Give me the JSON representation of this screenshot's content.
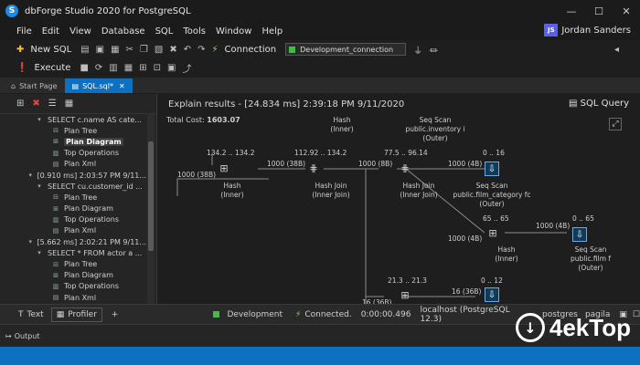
{
  "window": {
    "title": "dbForge Studio 2020 for PostgreSQL",
    "logo_letter": "S",
    "minimize": "—",
    "maximize": "☐",
    "close": "✕"
  },
  "menu": {
    "items": [
      "File",
      "Edit",
      "View",
      "Database",
      "SQL",
      "Tools",
      "Window",
      "Help"
    ],
    "user_initials": "JS",
    "user_name": "Jordan Sanders"
  },
  "toolbar1": {
    "new_sql": "New SQL",
    "connection_label": "Connection",
    "connection_value": "Development_connection"
  },
  "toolbar2": {
    "execute": "Execute"
  },
  "tabs": [
    {
      "label": "Start Page"
    },
    {
      "label": "SQL.sql*"
    }
  ],
  "tree": [
    {
      "indent": 38,
      "icon": "▾",
      "label": "SELECT c.name AS cate..."
    },
    {
      "indent": 56,
      "icon": "⊟",
      "label": "Plan Tree"
    },
    {
      "indent": 56,
      "icon": "⊞",
      "label": "Plan Diagram",
      "selected": true
    },
    {
      "indent": 56,
      "icon": "▥",
      "label": "Top Operations"
    },
    {
      "indent": 56,
      "icon": "▤",
      "label": "Plan Xml"
    },
    {
      "indent": 30,
      "icon": "▾",
      "label": "[0.910 ms] 2:03:57 PM 9/11..."
    },
    {
      "indent": 38,
      "icon": "▾",
      "label": "SELECT cu.customer_id ..."
    },
    {
      "indent": 56,
      "icon": "⊟",
      "label": "Plan Tree"
    },
    {
      "indent": 56,
      "icon": "⊞",
      "label": "Plan Diagram"
    },
    {
      "indent": 56,
      "icon": "▥",
      "label": "Top Operations"
    },
    {
      "indent": 56,
      "icon": "▤",
      "label": "Plan Xml"
    },
    {
      "indent": 30,
      "icon": "▾",
      "label": "[5.662 ms] 2:02:21 PM 9/11..."
    },
    {
      "indent": 38,
      "icon": "▾",
      "label": "SELECT * FROM actor a ..."
    },
    {
      "indent": 56,
      "icon": "⊟",
      "label": "Plan Tree"
    },
    {
      "indent": 56,
      "icon": "⊞",
      "label": "Plan Diagram"
    },
    {
      "indent": 56,
      "icon": "▥",
      "label": "Top Operations"
    },
    {
      "indent": 56,
      "icon": "▤",
      "label": "Plan Xml"
    }
  ],
  "results": {
    "header": "Explain results - [24.834 ms] 2:39:18 PM 9/11/2020",
    "sql_query": "SQL Query",
    "total_cost_label": "Total Cost:",
    "total_cost_value": "1603.07"
  },
  "diagram": {
    "top_labels": [
      {
        "text": "Hash\n(Inner)"
      },
      {
        "text": "Seq Scan\npublic.inventory i\n(Outer)"
      }
    ],
    "nodes": [
      {
        "id": "hash1",
        "cost": "134.2 .. 134.2",
        "label": "Hash\n(Inner)",
        "icon": "hash"
      },
      {
        "id": "hashjoin1",
        "cost": "112.92 .. 134.2",
        "label": "Hash Join\n(Inner Join)",
        "icon": "join"
      },
      {
        "id": "hashjoin2",
        "cost": "77.5 .. 96.14",
        "label": "Hash Join\n(Inner Join)",
        "icon": "join"
      },
      {
        "id": "seqscan1",
        "cost": "0 .. 16",
        "label": "Seq Scan\npublic.film_category fc\n(Outer)",
        "icon": "scan"
      },
      {
        "id": "hash2",
        "cost": "65 .. 65",
        "label": "Hash\n(Inner)",
        "icon": "hash"
      },
      {
        "id": "seqscan2",
        "cost": "0 .. 65",
        "label": "Seq Scan\npublic.film f\n(Outer)",
        "icon": "scan"
      },
      {
        "id": "node7",
        "cost": "21.3 .. 21.3",
        "label": "",
        "icon": "hash"
      },
      {
        "id": "node8",
        "cost": "0 .. 12",
        "label": "",
        "icon": "scan"
      }
    ],
    "edge_labels": [
      {
        "text": "1000 (38B)"
      },
      {
        "text": "1000 (38B)"
      },
      {
        "text": "1000 (8B)"
      },
      {
        "text": "1000 (4B)"
      },
      {
        "text": "1000 (4B)"
      },
      {
        "text": "1000 (4B)"
      },
      {
        "text": "16 (36B)"
      },
      {
        "text": "16 (36B)"
      }
    ]
  },
  "status": {
    "text_tab": "Text",
    "profiler_tab": "Profiler",
    "add": "+",
    "environment": "Development",
    "connected": "Connected.",
    "duration": "0:00:00.496",
    "server": "localhost (PostgreSQL 12.3)",
    "user": "postgres",
    "database": "pagila"
  },
  "output": {
    "label": "Output"
  },
  "watermark": {
    "brand": "4ekTop"
  },
  "colors": {
    "accent": "#0e70c0",
    "connected_green": "#3fbf3f",
    "user_avatar": "#5a5ff0"
  }
}
